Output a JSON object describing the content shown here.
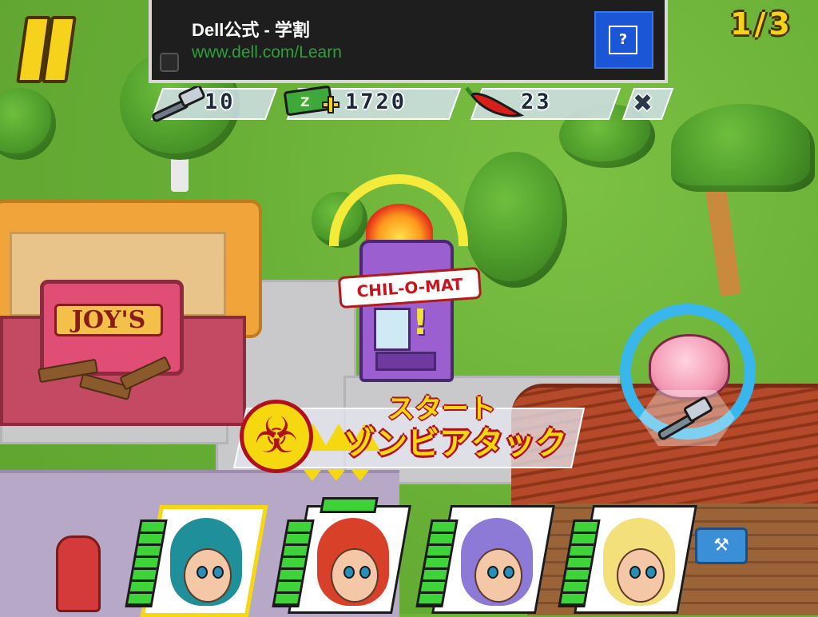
{
  "hud": {
    "level_counter": "1/3",
    "resources": {
      "hammers": "10",
      "money": "1720",
      "chili": "23"
    }
  },
  "ad": {
    "title": "Dell公式 - 学割",
    "url": "www.dell.com/Learn",
    "info_glyph": "?"
  },
  "world": {
    "shop_sign": "JOY'S",
    "machine_label": "CHIL-O-MAT"
  },
  "event": {
    "start_label": "スタート",
    "title": "ゾンビアタック"
  },
  "characters": [
    {
      "name": "teal-haired-girl",
      "hair": "#1f8f9a"
    },
    {
      "name": "red-haired-girl",
      "hair": "#d8402a"
    },
    {
      "name": "purple-haired-girl",
      "hair": "#8d7ad6"
    },
    {
      "name": "blonde-girl",
      "hair": "#f3e07a"
    }
  ],
  "icons": {
    "pause": "pause-icon",
    "hammer": "hammer-icon",
    "money": "money-icon",
    "chili": "chili-icon",
    "close": "close-icon",
    "brain": "brain-icon",
    "biohazard": "biohazard-icon",
    "warning": "warning-icon",
    "wrench": "wrench-icon"
  },
  "colors": {
    "hud_yellow": "#f7d21c",
    "alert_red": "#b0101a",
    "meter_green": "#3fd33a",
    "ad_url_green": "#2aa13a",
    "ad_button_blue": "#1a56d6",
    "brain_ring_blue": "#39b7ec"
  }
}
